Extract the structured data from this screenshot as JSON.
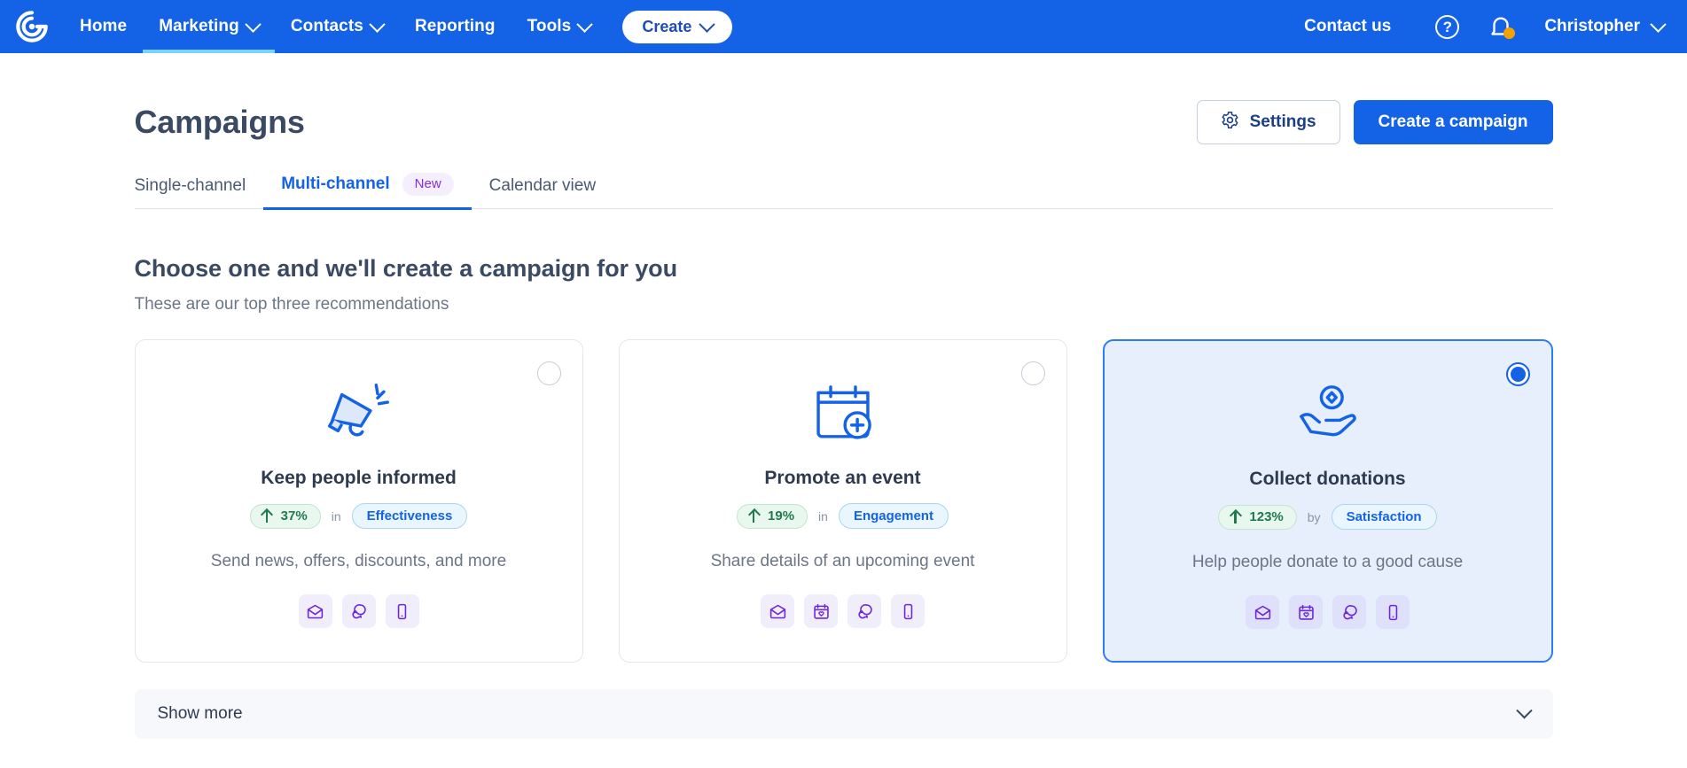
{
  "topnav": {
    "logo_name": "constant-contact-logo",
    "items": [
      {
        "label": "Home",
        "has_caret": false,
        "active": false
      },
      {
        "label": "Marketing",
        "has_caret": true,
        "active": true
      },
      {
        "label": "Contacts",
        "has_caret": true,
        "active": false
      },
      {
        "label": "Reporting",
        "has_caret": false,
        "active": false
      },
      {
        "label": "Tools",
        "has_caret": true,
        "active": false
      }
    ],
    "create_button": "Create",
    "contact_us": "Contact us",
    "help_icon": "?",
    "notification_icon": "bell-icon",
    "notification_dot_color": "#f5a201",
    "user_name": "Christopher",
    "background_color": "#1463e6",
    "active_underline_color": "#7bd3f7"
  },
  "header": {
    "title": "Campaigns",
    "settings_button": "Settings",
    "create_campaign_button": "Create a campaign"
  },
  "tabs": [
    {
      "label": "Single-channel",
      "active": false,
      "badge": null
    },
    {
      "label": "Multi-channel",
      "active": true,
      "badge": "New"
    },
    {
      "label": "Calendar view",
      "active": false,
      "badge": null
    }
  ],
  "section": {
    "title": "Choose one and we'll create a campaign for you",
    "subtitle": "These are our top three recommendations"
  },
  "cards": [
    {
      "illustration": "megaphone-icon",
      "title": "Keep people informed",
      "stat_value": "37%",
      "stat_connector": "in",
      "stat_metric": "Effectiveness",
      "description": "Send news, offers, discounts, and more",
      "channels": [
        "email-icon",
        "social-icon",
        "sms-icon"
      ],
      "selected": false
    },
    {
      "illustration": "calendar-plus-icon",
      "title": "Promote an event",
      "stat_value": "19%",
      "stat_connector": "in",
      "stat_metric": "Engagement",
      "description": "Share details of an upcoming event",
      "channels": [
        "email-icon",
        "event-icon",
        "social-icon",
        "sms-icon"
      ],
      "selected": false
    },
    {
      "illustration": "donation-hand-icon",
      "title": "Collect donations",
      "stat_value": "123%",
      "stat_connector": "by",
      "stat_metric": "Satisfaction",
      "description": "Help people donate to a good cause",
      "channels": [
        "email-icon",
        "event-icon",
        "social-icon",
        "sms-icon"
      ],
      "selected": true
    }
  ],
  "show_more": {
    "label": "Show more",
    "chevron": "chevron-down-icon"
  },
  "colors": {
    "brand_blue": "#1463e6",
    "title_navy": "#3a4a63",
    "muted_text": "#6b7686",
    "green_chip_text": "#1f7a4d",
    "purple_channel": "#6d28d9",
    "selected_card_bg": "#e7effd"
  }
}
